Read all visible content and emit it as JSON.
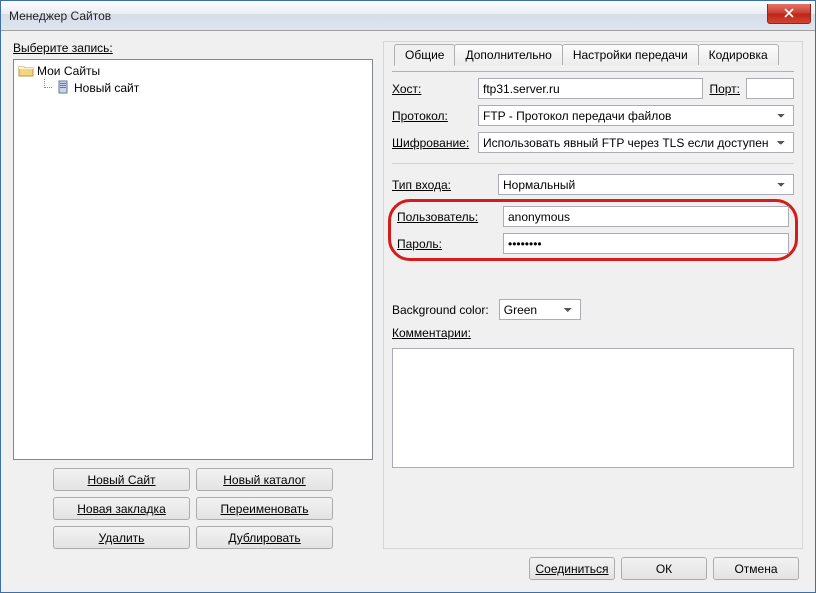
{
  "window": {
    "title": "Менеджер Сайтов"
  },
  "left": {
    "label": "Выберите запись:",
    "tree": {
      "root": "Мои Сайты",
      "child": "Новый сайт"
    },
    "buttons": {
      "new_site": "Новый Сайт",
      "new_folder": "Новый каталог",
      "new_bookmark": "Новая закладка",
      "rename": "Переименовать",
      "delete": "Удалить",
      "duplicate": "Дублировать"
    }
  },
  "tabs": {
    "general": "Общие",
    "advanced": "Дополнительно",
    "transfer": "Настройки передачи",
    "charset": "Кодировка"
  },
  "form": {
    "host_lbl": "Хост:",
    "host": "ftp31.server.ru",
    "port_lbl": "Порт:",
    "port": "",
    "protocol_lbl": "Протокол:",
    "protocol": "FTP - Протокол передачи файлов",
    "encryption_lbl": "Шифрование:",
    "encryption": "Использовать явный FTP через TLS если доступен",
    "logon_lbl": "Тип входа:",
    "logon": "Нормальный",
    "user_lbl": "Пользователь:",
    "user": "anonymous",
    "pass_lbl": "Пароль:",
    "pass": "••••••••",
    "bg_lbl": "Background color:",
    "bg": "Green",
    "comments_lbl": "Комментарии:",
    "comments": ""
  },
  "footer": {
    "connect": "Соединиться",
    "ok": "ОК",
    "cancel": "Отмена"
  }
}
